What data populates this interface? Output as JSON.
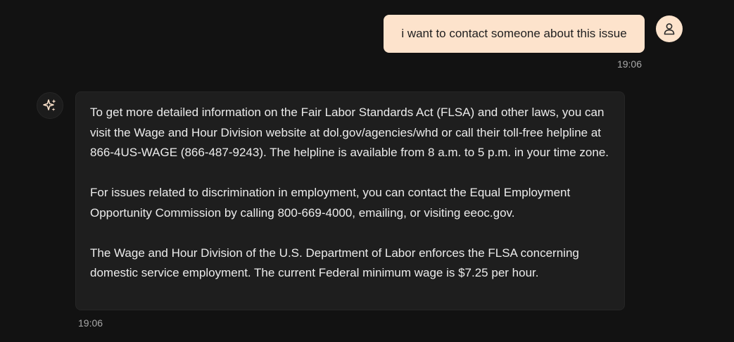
{
  "user_message": {
    "text": "i want to contact someone about this issue",
    "time": "19:06",
    "avatar_icon": "user-icon",
    "bubble_color": "#fde3cc"
  },
  "assistant_message": {
    "avatar_icon": "sparkle-icon",
    "paragraphs": [
      "To get more detailed information on the Fair Labor Standards Act (FLSA) and other laws, you can visit the Wage and Hour Division website at dol.gov/agencies/whd or call their toll-free helpline at 866-4US-WAGE (866-487-9243). The helpline is available from 8 a.m. to 5 p.m. in your time zone.",
      "For issues related to discrimination in employment, you can contact the Equal Employment Opportunity Commission by calling 800-669-4000, emailing, or visiting eeoc.gov.",
      "The Wage and Hour Division of the U.S. Department of Labor enforces the FLSA concerning domestic service employment. The current Federal minimum wage is $7.25 per hour."
    ],
    "time": "19:06",
    "bubble_color": "#1e1e1e"
  },
  "background_color": "#121212"
}
